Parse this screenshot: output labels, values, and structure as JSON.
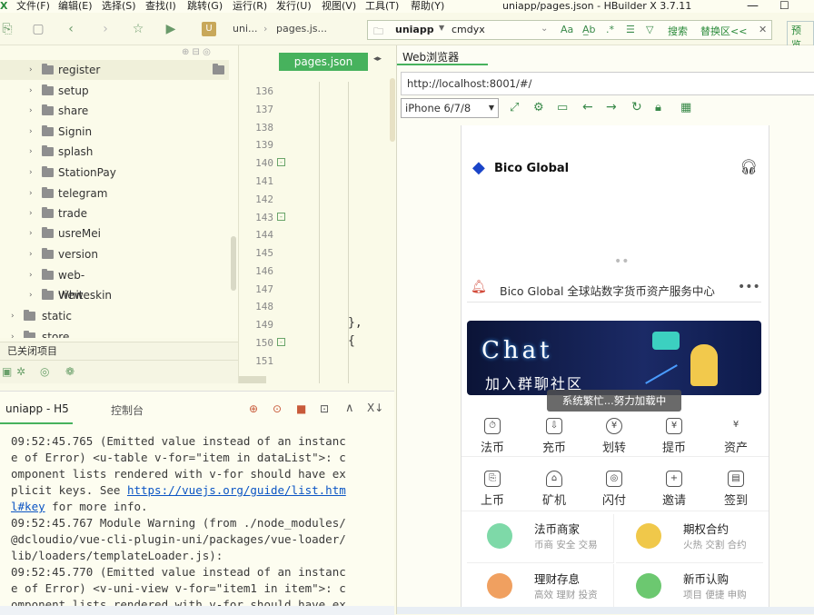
{
  "menu": [
    "文件(F)",
    "编辑(E)",
    "选择(S)",
    "查找(I)",
    "跳转(G)",
    "运行(R)",
    "发行(U)",
    "视图(V)",
    "工具(T)",
    "帮助(Y)"
  ],
  "window_title": "uniapp/pages.json - HBuilder X 3.7.11",
  "toolbar": {
    "crumb1": "uni...",
    "crumb2": "pages.js...",
    "project": "uniapp",
    "search_value": "cmdyx",
    "search_btn": "搜索",
    "replace_btn": "替换区<<",
    "preview_btn": "预览"
  },
  "tree": {
    "items": [
      "register",
      "setup",
      "share",
      "Signin",
      "splash",
      "StationPay",
      "telegram",
      "trade",
      "usreMei",
      "version",
      "web-view",
      "Whiteskin"
    ],
    "static": "static",
    "store": "store",
    "closed_projects": "已关闭项目"
  },
  "editor": {
    "tab": "pages.json",
    "lines": [
      "136",
      "137",
      "138",
      "139",
      "140",
      "141",
      "142",
      "143",
      "144",
      "145",
      "146",
      "147",
      "148",
      "149",
      "150",
      "151"
    ],
    "code_149": "},",
    "code_150": "{"
  },
  "console": {
    "tab1": "uniapp - H5",
    "tab2": "控制台",
    "log1_a": "09:52:45.765 (Emitted value instead of an instanc\ne of Error) <u-table v-for=\"item in dataList\">: c\nomponent lists rendered with v-for should have ex\nplicit keys. See ",
    "log1_link": "https://vuejs.org/guide/list.htm\nl#key",
    "log1_b": " for more info.\n09:52:45.767 Module Warning (from ./node_modules/\n@dcloudio/vue-cli-plugin-uni/packages/vue-loader/\nlib/loaders/templateLoader.js):\n09:52:45.770 (Emitted value instead of an instanc\ne of Error) <v-uni-view v-for=\"item1 in item\">: c\nomponent lists rendered with v-for should have ex"
  },
  "browser": {
    "tab": "Web浏览器",
    "url": "http://localhost:8001/#/",
    "device": "iPhone 6/7/8"
  },
  "app": {
    "brand": "Bico Global",
    "notice": "Bico Global 全球站数字货币资产服务中心",
    "banner_title": "Chat",
    "banner_sub": "加入群聊社区",
    "toast": "系统繁忙...努力加载中",
    "grid_row1": [
      "法币",
      "充币",
      "划转",
      "提币",
      "资产"
    ],
    "grid_row2": [
      "上币",
      "矿机",
      "闪付",
      "邀请",
      "签到"
    ],
    "cards": [
      {
        "title": "法币商家",
        "sub": "币商 安全 交易",
        "color": "#7ed9a8"
      },
      {
        "title": "期权合约",
        "sub": "火热 交割 合约",
        "color": "#f0c84a"
      },
      {
        "title": "理财存息",
        "sub": "高效 理财 投资",
        "color": "#f0a060"
      },
      {
        "title": "新币认购",
        "sub": "项目 便捷 申购",
        "color": "#6cc870"
      }
    ]
  }
}
